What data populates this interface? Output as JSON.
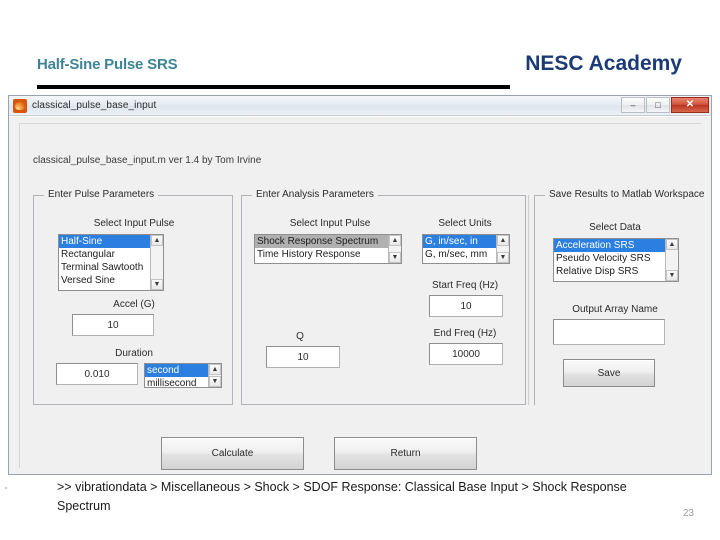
{
  "slide": {
    "title": "Half-Sine Pulse SRS",
    "brand": "NESC Academy",
    "page_number": "23",
    "breadcrumb": ">> vibrationdata > Miscellaneous > Shock > SDOF Response: Classical Base Input > Shock Response Spectrum",
    "accent_title_color": "#3d8596",
    "accent_brand_color": "#1b3a78"
  },
  "window": {
    "title": "classical_pulse_base_input",
    "version_line": "classical_pulse_base_input.m  ver 1.4  by Tom Irvine",
    "controls": {
      "minimize": "–",
      "maximize": "□",
      "close": "✕"
    }
  },
  "pulse_panel": {
    "title": "Enter Pulse Parameters",
    "select_input_pulse_label": "Select Input Pulse",
    "input_pulse_options": [
      "Half-Sine",
      "Rectangular",
      "Terminal Sawtooth",
      "Versed Sine"
    ],
    "input_pulse_selected": "Half-Sine",
    "accel_label": "Accel (G)",
    "accel_value": "10",
    "duration_label": "Duration",
    "duration_value": "0.010",
    "duration_unit_options": [
      "second",
      "millisecond"
    ],
    "duration_unit_selected": "second"
  },
  "analysis_panel": {
    "title": "Enter Analysis Parameters",
    "select_input_pulse_label": "Select Input Pulse",
    "analysis_type_options": [
      "Shock Response Spectrum",
      "Time History Response"
    ],
    "analysis_type_selected": "Shock Response Spectrum",
    "select_units_label": "Select Units",
    "units_options": [
      "G, in/sec, in",
      "G, m/sec, mm"
    ],
    "units_selected": "G, in/sec, in",
    "start_freq_label": "Start Freq (Hz)",
    "start_freq_value": "10",
    "end_freq_label": "End Freq (Hz)",
    "end_freq_value": "10000",
    "q_label": "Q",
    "q_value": "10"
  },
  "save_panel": {
    "title": "Save Results to Matlab Workspace",
    "select_data_label": "Select Data",
    "data_options": [
      "Acceleration SRS",
      "Pseudo Velocity SRS",
      "Relative Disp SRS"
    ],
    "data_selected": "Acceleration SRS",
    "output_array_label": "Output Array Name",
    "output_array_value": "",
    "save_button": "Save"
  },
  "actions": {
    "calculate_button": "Calculate",
    "return_button": "Return"
  },
  "scroll": {
    "up": "▲",
    "down": "▼"
  }
}
